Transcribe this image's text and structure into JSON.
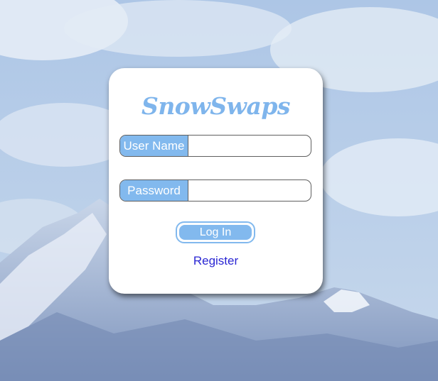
{
  "background": {
    "sky_color": "#b9cde6",
    "mountain_color": "#8aa2c6"
  },
  "card": {
    "logo": "SnowSwaps",
    "username": {
      "label": "User Name",
      "value": "",
      "placeholder": ""
    },
    "password": {
      "label": "Password",
      "value": "",
      "placeholder": ""
    },
    "login_label": "Log In",
    "register_label": "Register"
  },
  "colors": {
    "accent": "#82b9ee",
    "logo": "#7fb5ec",
    "link": "#2a26d3"
  }
}
